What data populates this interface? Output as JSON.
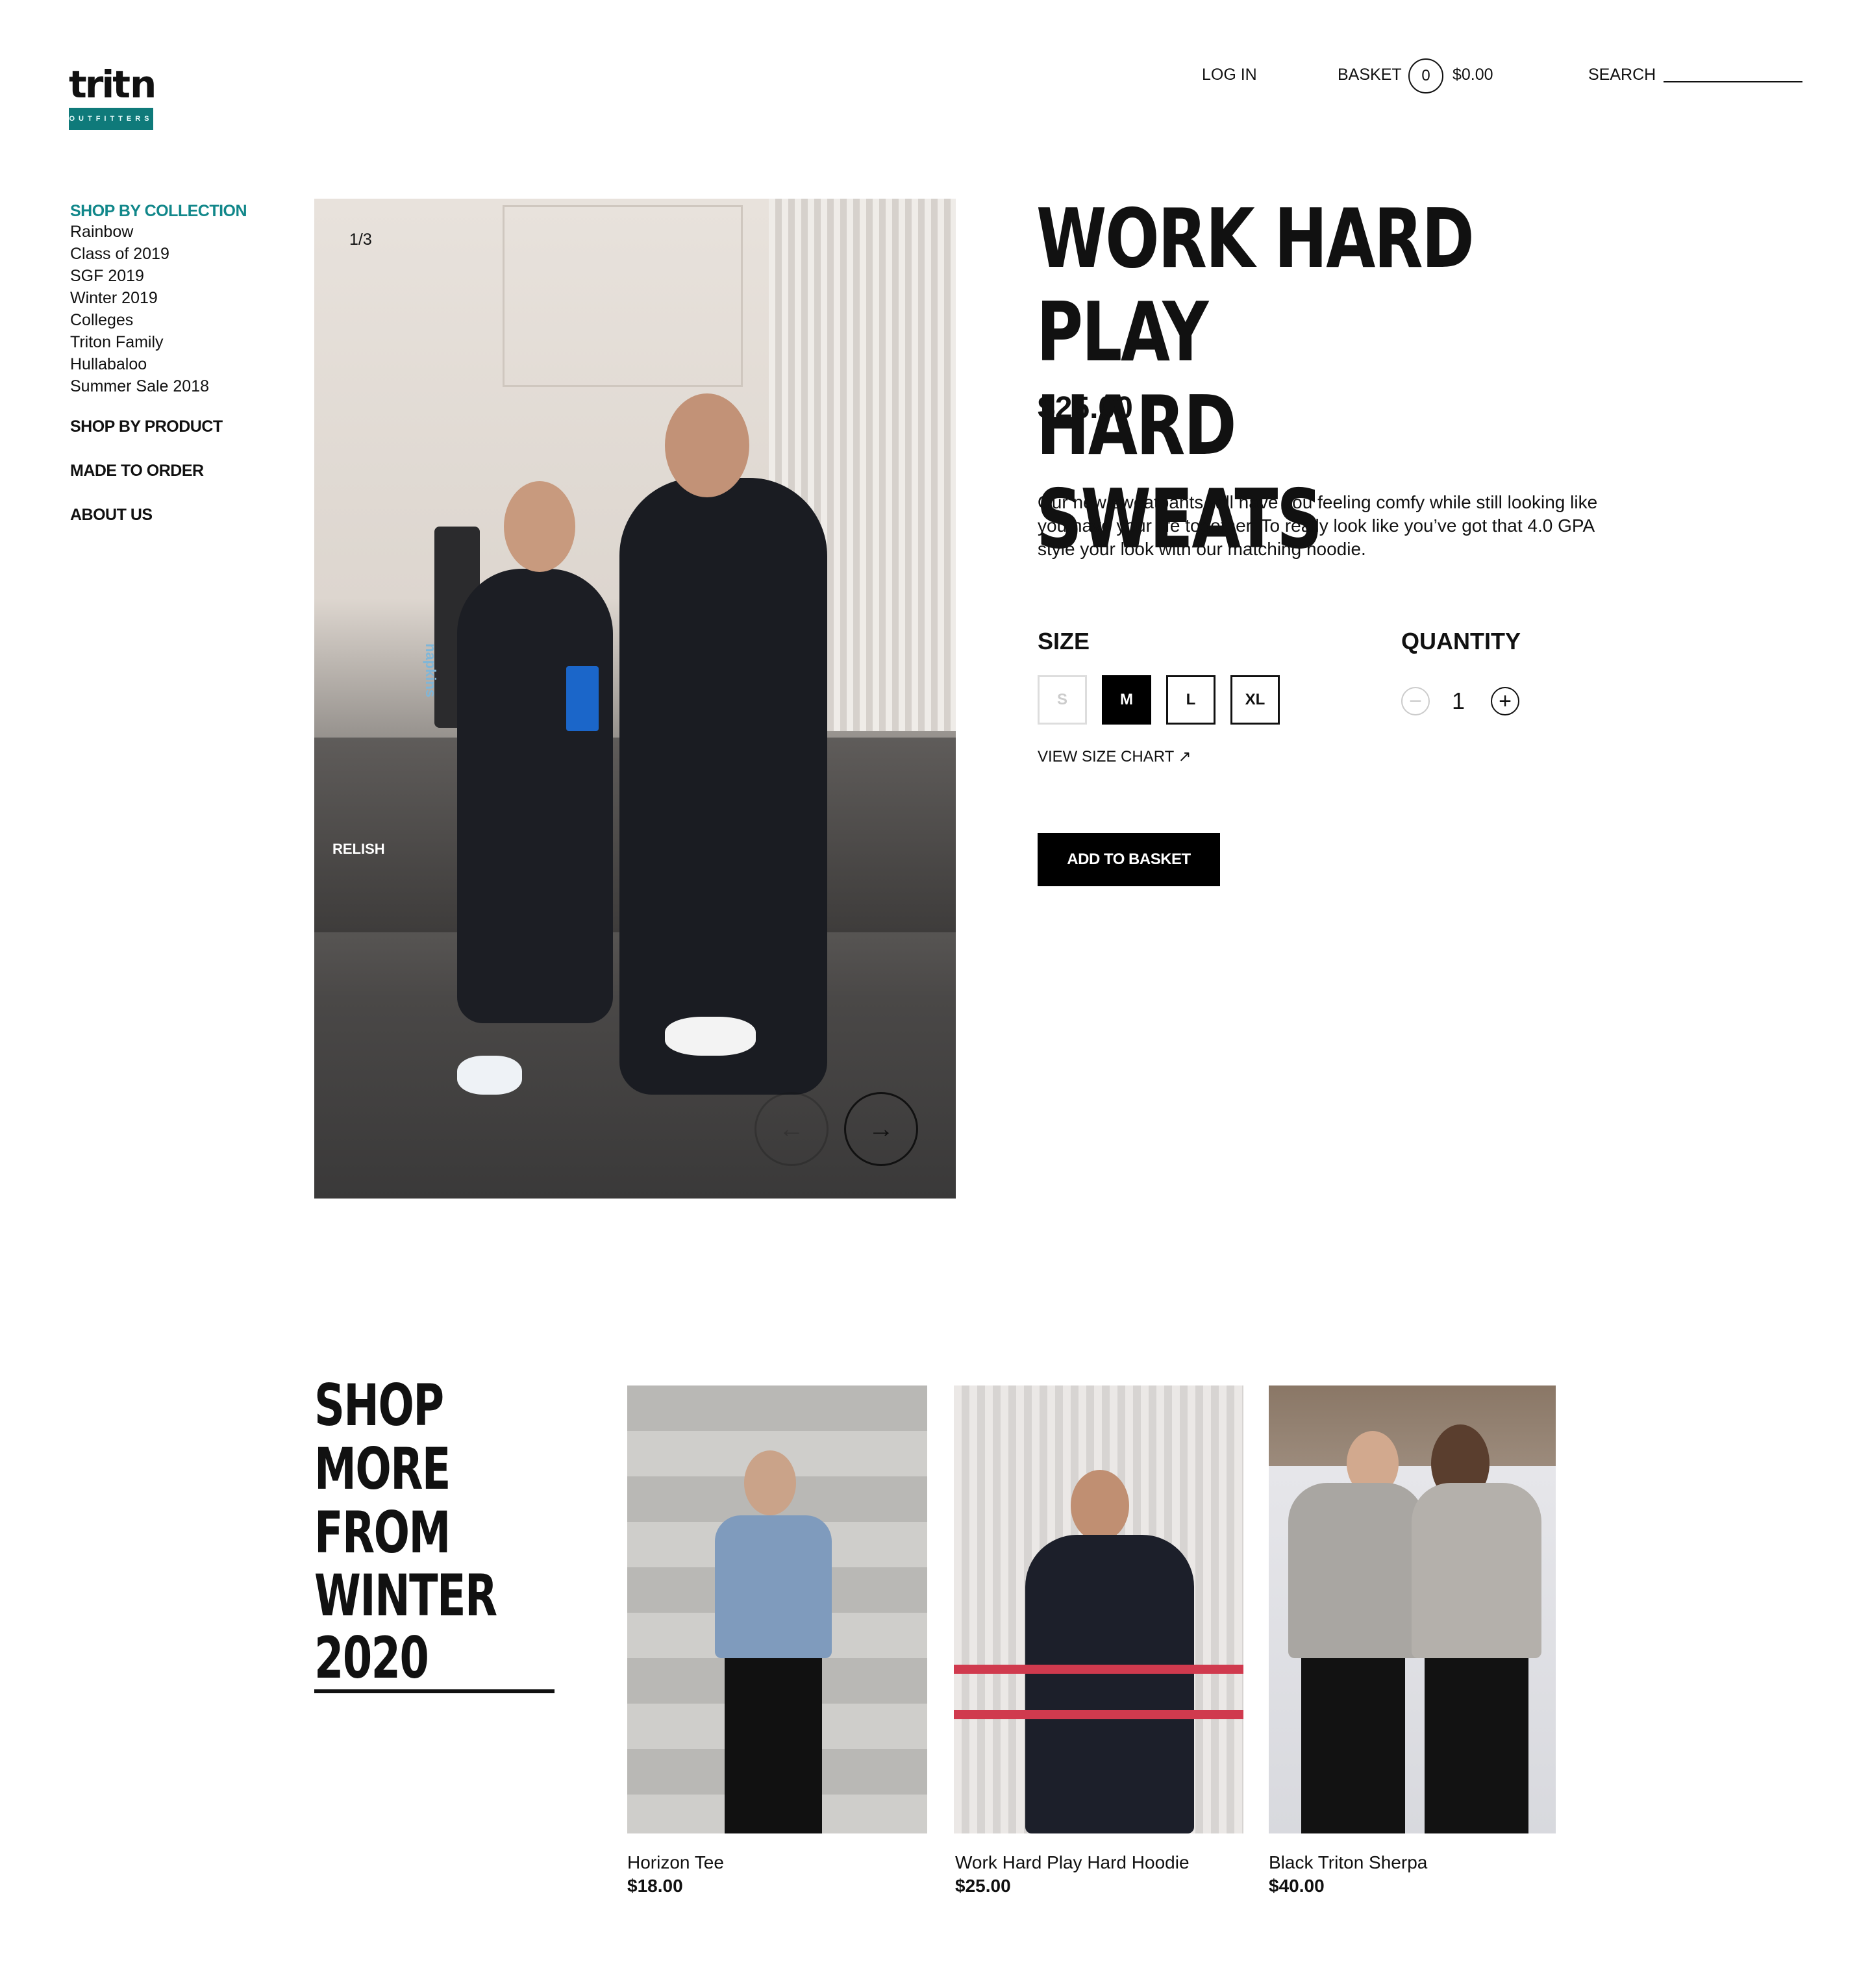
{
  "header": {
    "logo_word": "triton",
    "logo_sub": "OUTFITTERS",
    "login_label": "LOG IN",
    "basket_label": "BASKET",
    "basket_count": "0",
    "basket_total": "$0.00",
    "search_label": "SEARCH"
  },
  "sidebar": {
    "collection_heading": "SHOP BY COLLECTION",
    "collections": [
      "Rainbow",
      "Class of 2019",
      "SGF 2019",
      "Winter 2019",
      "Colleges",
      "Triton Family",
      "Hullabaloo",
      "Summer Sale 2018"
    ],
    "product_heading": "SHOP BY PRODUCT",
    "made_to_order": "MADE TO ORDER",
    "about": "ABOUT US"
  },
  "gallery": {
    "counter": "1/3",
    "photo_labels": [
      "napkins",
      "RELISH"
    ]
  },
  "product": {
    "title_line1": "WORK HARD PLAY",
    "title_line2": "HARD SWEATS",
    "price": "$25.00",
    "description": "Our new sweatpants will have you feeling comfy while still looking like you have your life together. To really look like you’ve got that 4.0 GPA style your look with our matching hoodie.",
    "size_label": "SIZE",
    "sizes": [
      "S",
      "M",
      "L",
      "XL"
    ],
    "selected_size": "M",
    "quantity_label": "QUANTITY",
    "quantity": "1",
    "size_chart": "VIEW SIZE CHART ↗",
    "add_to_basket": "ADD TO BASKET"
  },
  "more": {
    "line1": "SHOP MORE",
    "line2": "FROM",
    "line3": "WINTER 2020",
    "items": [
      {
        "name": "Horizon Tee",
        "price": "$18.00"
      },
      {
        "name": "Work Hard Play Hard Hoodie",
        "price": "$25.00"
      },
      {
        "name": "Black Triton Sherpa",
        "price": "$40.00"
      }
    ]
  },
  "colors": {
    "accent": "#11878a",
    "logo_badge": "#0f7a7a",
    "text": "#111111",
    "button": "#000000"
  },
  "icons": {
    "prev": "arrow-left-icon",
    "next": "arrow-right-icon",
    "minus": "minus-circle-icon",
    "plus": "plus-circle-icon",
    "external": "external-arrow-icon"
  }
}
